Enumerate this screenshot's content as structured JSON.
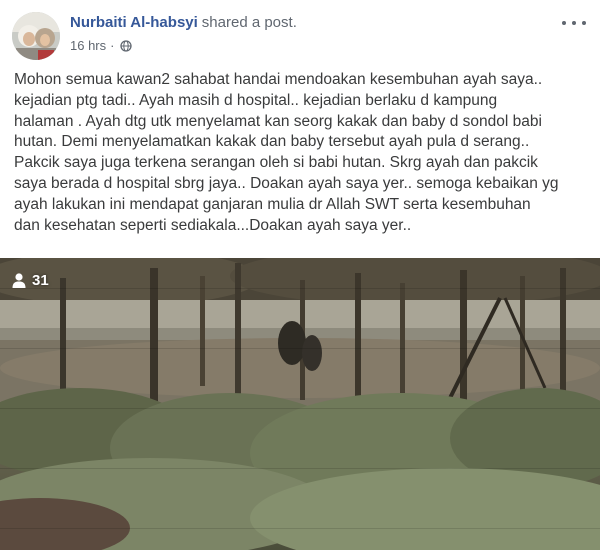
{
  "post": {
    "author_name": "Nurbaiti Al-habsyi",
    "action_text": "shared a post.",
    "timestamp": "16 hrs",
    "separator": "·",
    "privacy_icon": "globe-icon",
    "more_icon": "more-options-icon",
    "text_lines": [
      "Mohon semua kawan2 sahabat handai mendoakan kesembuhan ayah saya..",
      "kejadian ptg tadi.. Ayah masih d hospital.. kejadian berlaku d kampung",
      "halaman . Ayah dtg utk menyelamat kan seorg kakak dan baby d sondol babi",
      "hutan. Demi menyelamatkan kakak dan baby tersebut ayah pula d serang..",
      "Pakcik saya juga terkena serangan oleh si babi hutan. Skrg ayah dan pakcik",
      "saya berada d hospital sbrg jaya.. Doakan ayah saya yer.. semoga kebaikan yg",
      "ayah lakukan ini mendapat ganjaran mulia dr Allah SWT serta kesembuhan",
      "dan kesehatan seperti sediakala...Doakan ayah saya yer.."
    ]
  },
  "media": {
    "view_icon": "person-icon",
    "view_count": "31"
  },
  "colors": {
    "author": "#365899",
    "meta": "#606770",
    "body_text": "#3a3b3c"
  }
}
